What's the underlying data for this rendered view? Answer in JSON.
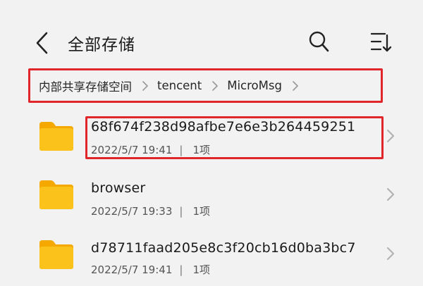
{
  "header": {
    "title": "全部存储",
    "back_icon": "chevron-left-icon",
    "search_icon": "search-icon",
    "sort_icon": "sort-icon"
  },
  "breadcrumb": {
    "items": [
      "内部共享存储空间",
      "tencent",
      "MicroMsg"
    ],
    "separator_icon": "chevron-right-icon"
  },
  "files": [
    {
      "name": "68f674f238d98afbe7e6e3b264459251",
      "date": "2022/5/7 19:41",
      "count": "1项",
      "icon": "folder-icon"
    },
    {
      "name": "browser",
      "date": "2022/5/7 19:33",
      "count": "1项",
      "icon": "folder-icon"
    },
    {
      "name": "d78711faad205e8c3f20cb16d0ba3bc7",
      "date": "2022/5/7 19:41",
      "count": "1项",
      "icon": "folder-icon"
    }
  ],
  "colors": {
    "background": "#f2f2f2",
    "highlight": "#e0262a",
    "folder": "#f9b300"
  }
}
